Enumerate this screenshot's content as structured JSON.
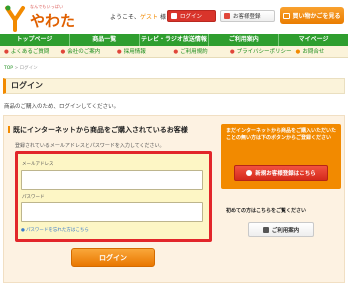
{
  "header": {
    "logo_tagline": "なんでもいっぱい",
    "logo_text": "やわた",
    "welcome_prefix": "ようこそ、",
    "welcome_name": "ゲスト",
    "welcome_suffix": " 様",
    "login_label": "ログイン",
    "member_label": "お客様登録",
    "cart_label": "買い物かごを見る"
  },
  "nav": {
    "items": [
      "トップページ",
      "商品一覧",
      "テレビ・ラジオ放送情報",
      "ご利用案内",
      "マイページ"
    ]
  },
  "subnav": {
    "items": [
      "よくあるご質問",
      "会社のご案内",
      "採用情報",
      "ご利用規約",
      "プライバシーポリシー",
      "お問合せ"
    ]
  },
  "breadcrumb": {
    "home": "TOP",
    "current": "ログイン"
  },
  "page": {
    "title": "ログイン",
    "intro": "商品のご購入のため、ログインしてください。"
  },
  "login_form": {
    "title": "既にインターネットから商品をご購入されているお客様",
    "description": "登録されているメールアドレスとパスワードを入力してください。",
    "email_label": "メールアドレス",
    "email_value": "",
    "password_label": "パスワード",
    "password_value": "",
    "forgot_link": "パスワードを忘れた方はこちら",
    "submit_label": "ログイン"
  },
  "new_customer": {
    "text": "まだインターネットから商品をご購入いただいたことの無い方は下のボタンからご登録ください",
    "button_label": "新規お客様登録はこちら",
    "first_time_text": "初めての方はこちらをご覧ください",
    "guide_button_label": "ご利用案内"
  },
  "colors": {
    "brand_green": "#2f9e2f",
    "brand_orange": "#f28a00",
    "alert_red": "#e2262a"
  }
}
